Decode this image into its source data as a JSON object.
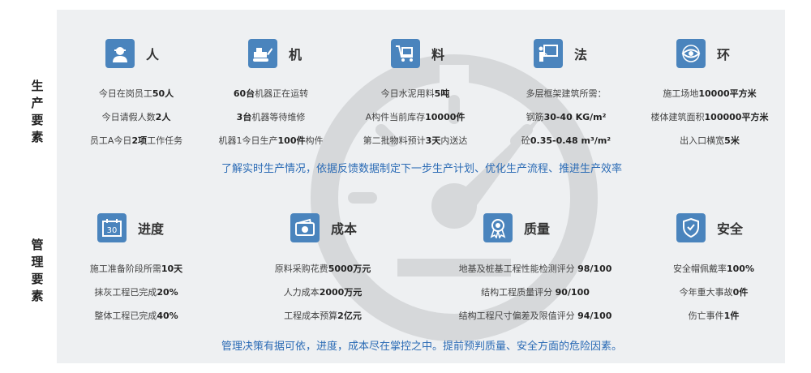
{
  "sections": {
    "production": {
      "side_label": [
        "生",
        "产",
        "要",
        "素"
      ],
      "summary": "了解实时生产情况，依据反馈数据制定下一步生产计划、优化生产流程、推进生产效率",
      "cards": [
        {
          "title": "人",
          "icon": "worker-icon",
          "lines": [
            [
              "今日在岗员工",
              "50人",
              ""
            ],
            [
              "今日请假人数",
              "2人",
              ""
            ],
            [
              "员工A今日",
              "2项",
              "工作任务"
            ]
          ]
        },
        {
          "title": "机",
          "icon": "machine-icon",
          "lines": [
            [
              "",
              "60台",
              "机器正在运转"
            ],
            [
              "",
              "3台",
              "机器等待维修"
            ],
            [
              "机器1今日生产",
              "100件",
              "构件"
            ]
          ]
        },
        {
          "title": "料",
          "icon": "material-cart-icon",
          "lines": [
            [
              "今日水泥用料",
              "5吨",
              ""
            ],
            [
              "A构件当前库存",
              "10000件",
              ""
            ],
            [
              "第二批物料预计",
              "3天",
              "内送达"
            ]
          ]
        },
        {
          "title": "法",
          "icon": "method-presentation-icon",
          "lines": [
            [
              "多层框架建筑所需：",
              "",
              ""
            ],
            [
              "钢筋",
              "30-40 KG/m²",
              ""
            ],
            [
              "砼",
              "0.35-0.48 m³/m²",
              ""
            ]
          ]
        },
        {
          "title": "环",
          "icon": "environment-eye-icon",
          "lines": [
            [
              "施工场地",
              "10000平方米",
              ""
            ],
            [
              "楼体建筑面积",
              "100000平方米",
              ""
            ],
            [
              "出入口横宽",
              "5米",
              ""
            ]
          ]
        }
      ]
    },
    "management": {
      "side_label": [
        "管",
        "理",
        "要",
        "素"
      ],
      "summary": "管理决策有据可依，进度，成本尽在掌控之中。提前预判质量、安全方面的危险因素。",
      "cards": [
        {
          "title": "进度",
          "icon": "calendar-icon",
          "icon_text": "30",
          "lines": [
            [
              "施工准备阶段所需",
              "10天",
              ""
            ],
            [
              "抹灰工程已完成",
              "20%",
              ""
            ],
            [
              "整体工程已完成",
              "40%",
              ""
            ]
          ]
        },
        {
          "title": "成本",
          "icon": "cost-wallet-icon",
          "lines": [
            [
              "原料采购花费",
              "5000万元",
              ""
            ],
            [
              "人力成本",
              "2000万元",
              ""
            ],
            [
              "工程成本预算",
              "2亿元",
              ""
            ]
          ]
        },
        {
          "title": "质量",
          "icon": "quality-medal-icon",
          "lines": [
            [
              "地基及桩基工程性能检测评分 ",
              "98/100",
              ""
            ],
            [
              "结构工程质量评分 ",
              "90/100",
              ""
            ],
            [
              "结构工程尺寸偏差及限值评分 ",
              "94/100",
              ""
            ]
          ]
        },
        {
          "title": "安全",
          "icon": "safety-shield-icon",
          "lines": [
            [
              "安全帽佩戴率",
              "100%",
              ""
            ],
            [
              "今年重大事故",
              "0件",
              ""
            ],
            [
              "伤亡事件",
              "1件",
              ""
            ]
          ]
        }
      ]
    }
  },
  "colors": {
    "icon_bg": "#4a84bd",
    "accent_text": "#2b6bb5",
    "panel_bg": "#eef0f2"
  }
}
